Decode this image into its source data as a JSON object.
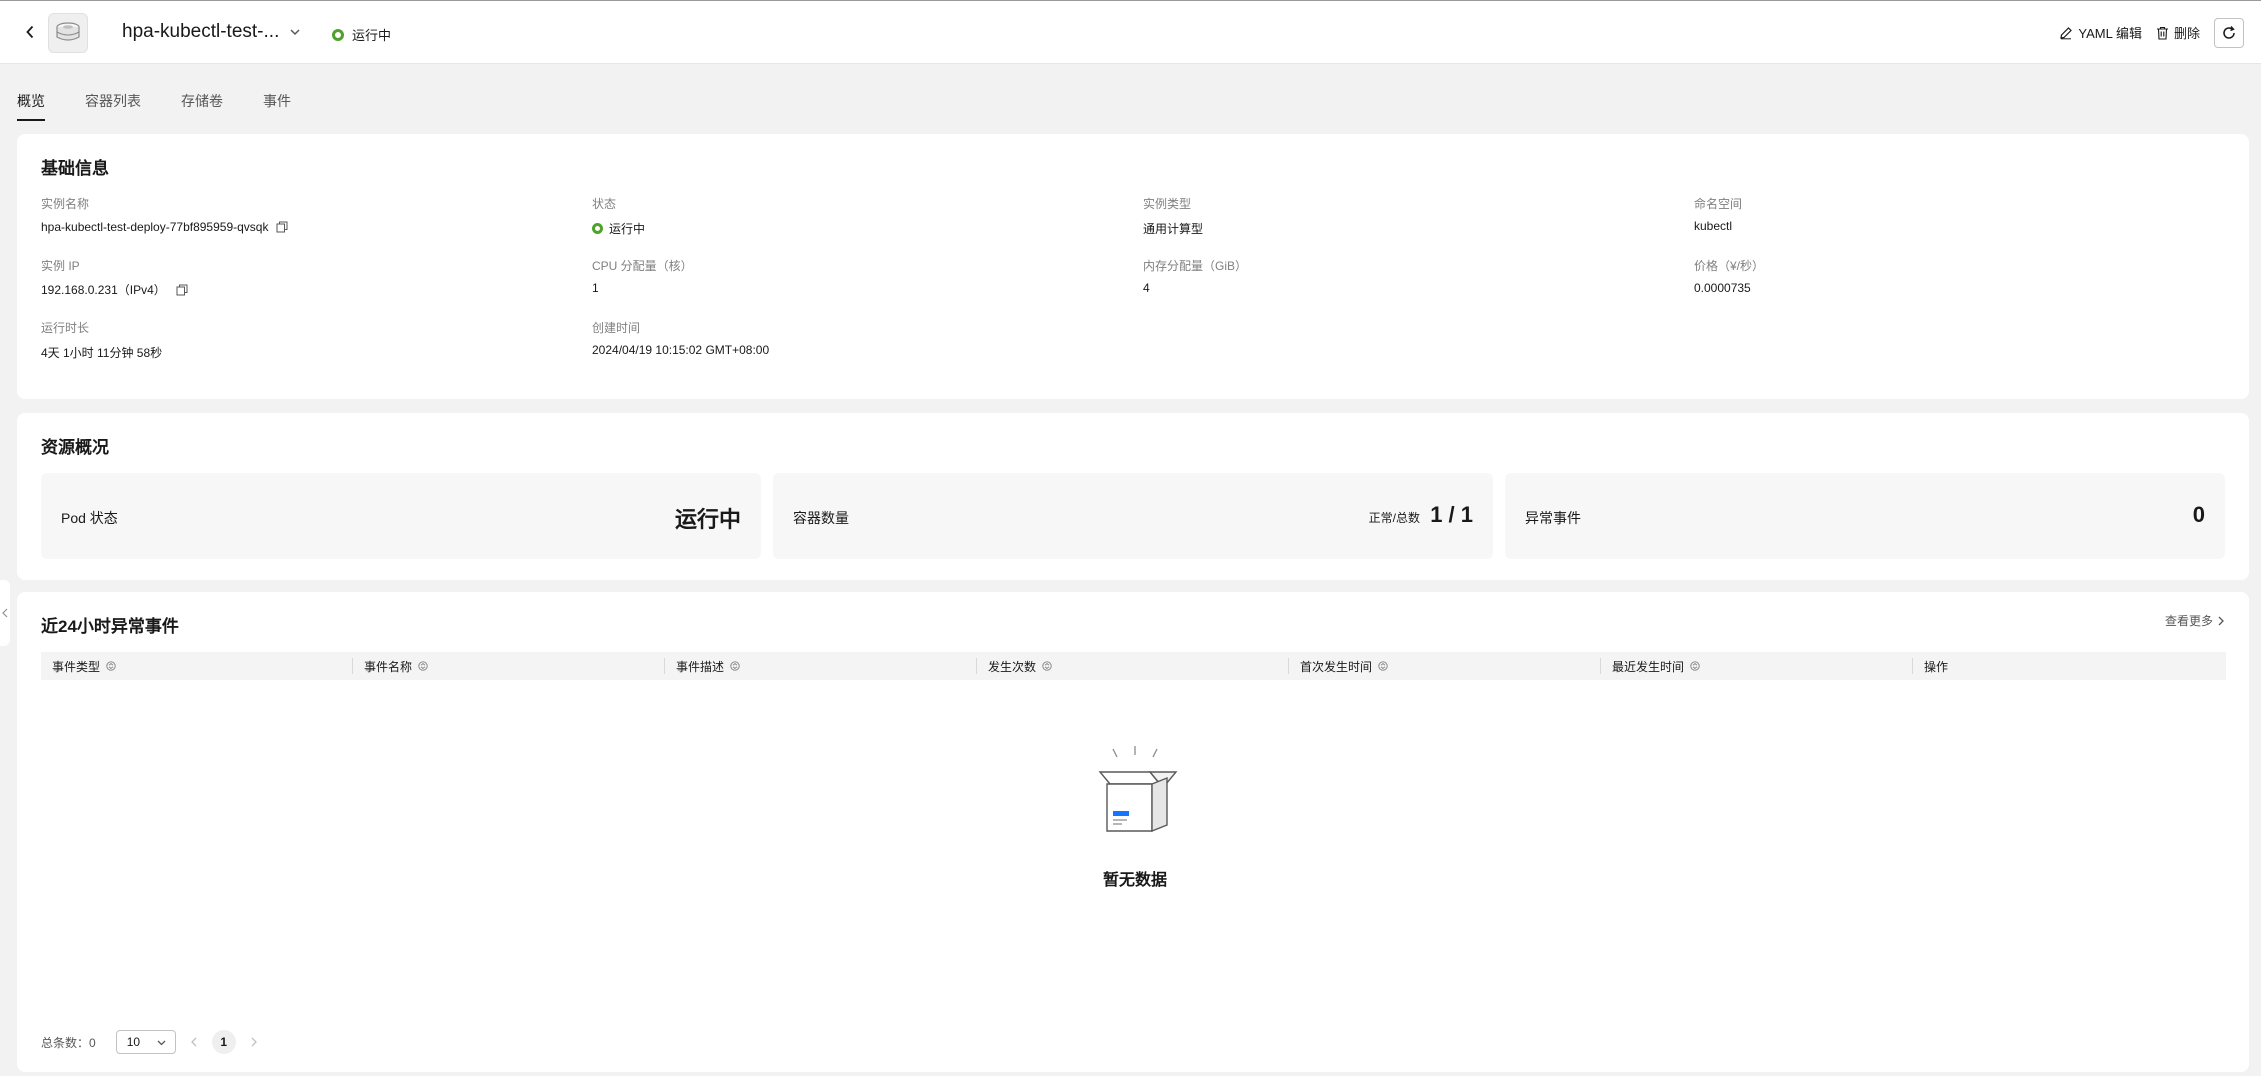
{
  "header": {
    "title": "hpa-kubectl-test-...",
    "status": "运行中",
    "actions": {
      "yaml_edit": "YAML 编辑",
      "delete": "删除"
    }
  },
  "tabs": [
    {
      "label": "概览"
    },
    {
      "label": "容器列表"
    },
    {
      "label": "存储卷"
    },
    {
      "label": "事件"
    }
  ],
  "basic_info": {
    "title": "基础信息",
    "fields": [
      {
        "label": "实例名称",
        "value": "hpa-kubectl-test-deploy-77bf895959-qvsqk"
      },
      {
        "label": "状态",
        "value": "运行中"
      },
      {
        "label": "实例类型",
        "value": "通用计算型"
      },
      {
        "label": "命名空间",
        "value": "kubectl"
      },
      {
        "label": "实例 IP",
        "value": "192.168.0.231（IPv4）"
      },
      {
        "label": "CPU 分配量（核）",
        "value": "1"
      },
      {
        "label": "内存分配量（GiB）",
        "value": "4"
      },
      {
        "label": "价格（¥/秒）",
        "value": "0.0000735"
      },
      {
        "label": "运行时长",
        "value": "4天 1小时 11分钟 58秒"
      },
      {
        "label": "创建时间",
        "value": "2024/04/19 10:15:02 GMT+08:00"
      }
    ]
  },
  "resource_overview": {
    "title": "资源概况",
    "pod_status": {
      "label": "Pod 状态",
      "value": "运行中"
    },
    "containers": {
      "label": "容器数量",
      "sub": "正常/总数",
      "value": "1 / 1"
    },
    "abnormal_events": {
      "label": "异常事件",
      "value": "0"
    }
  },
  "events": {
    "title": "近24小时异常事件",
    "more": "查看更多",
    "columns": [
      {
        "label": "事件类型"
      },
      {
        "label": "事件名称"
      },
      {
        "label": "事件描述"
      },
      {
        "label": "发生次数"
      },
      {
        "label": "首次发生时间"
      },
      {
        "label": "最近发生时间"
      },
      {
        "label": "操作"
      }
    ],
    "empty_text": "暂无数据",
    "footer": {
      "total": "总条数：0",
      "page_size": "10",
      "page": "1"
    }
  },
  "colors": {
    "running": "#4fa22b",
    "accent": "#1476ff"
  }
}
